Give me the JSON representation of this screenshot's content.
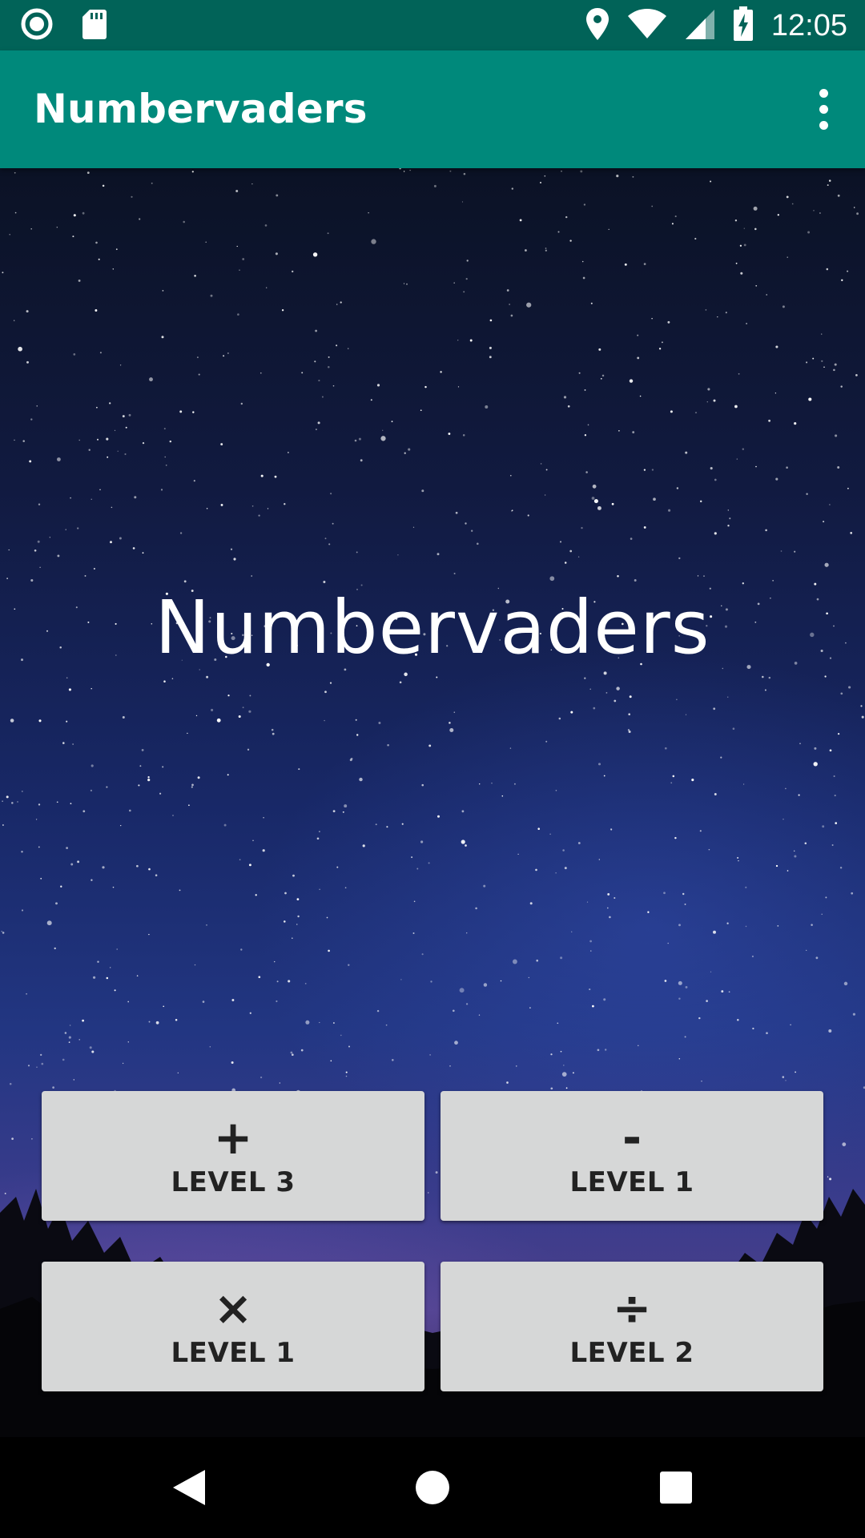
{
  "status_bar": {
    "time": "12:05",
    "icons": [
      "record-icon",
      "sd-card-icon",
      "location-icon",
      "wifi-icon",
      "signal-icon",
      "battery-charging-icon"
    ]
  },
  "app_bar": {
    "title": "Numbervaders",
    "menu_icon": "overflow-menu-icon"
  },
  "main": {
    "title": "Numbervaders",
    "buttons": [
      {
        "operator": "+",
        "level": "LEVEL 3"
      },
      {
        "operator": "-",
        "level": "LEVEL 1"
      },
      {
        "operator": "×",
        "level": "LEVEL 1"
      },
      {
        "operator": "÷",
        "level": "LEVEL 2"
      }
    ]
  },
  "nav_bar": {
    "icons": [
      "back-icon",
      "home-icon",
      "recents-icon"
    ]
  },
  "colors": {
    "status_bar": "#016358",
    "app_bar": "#00897B",
    "button_bg": "#d6d7d7"
  }
}
